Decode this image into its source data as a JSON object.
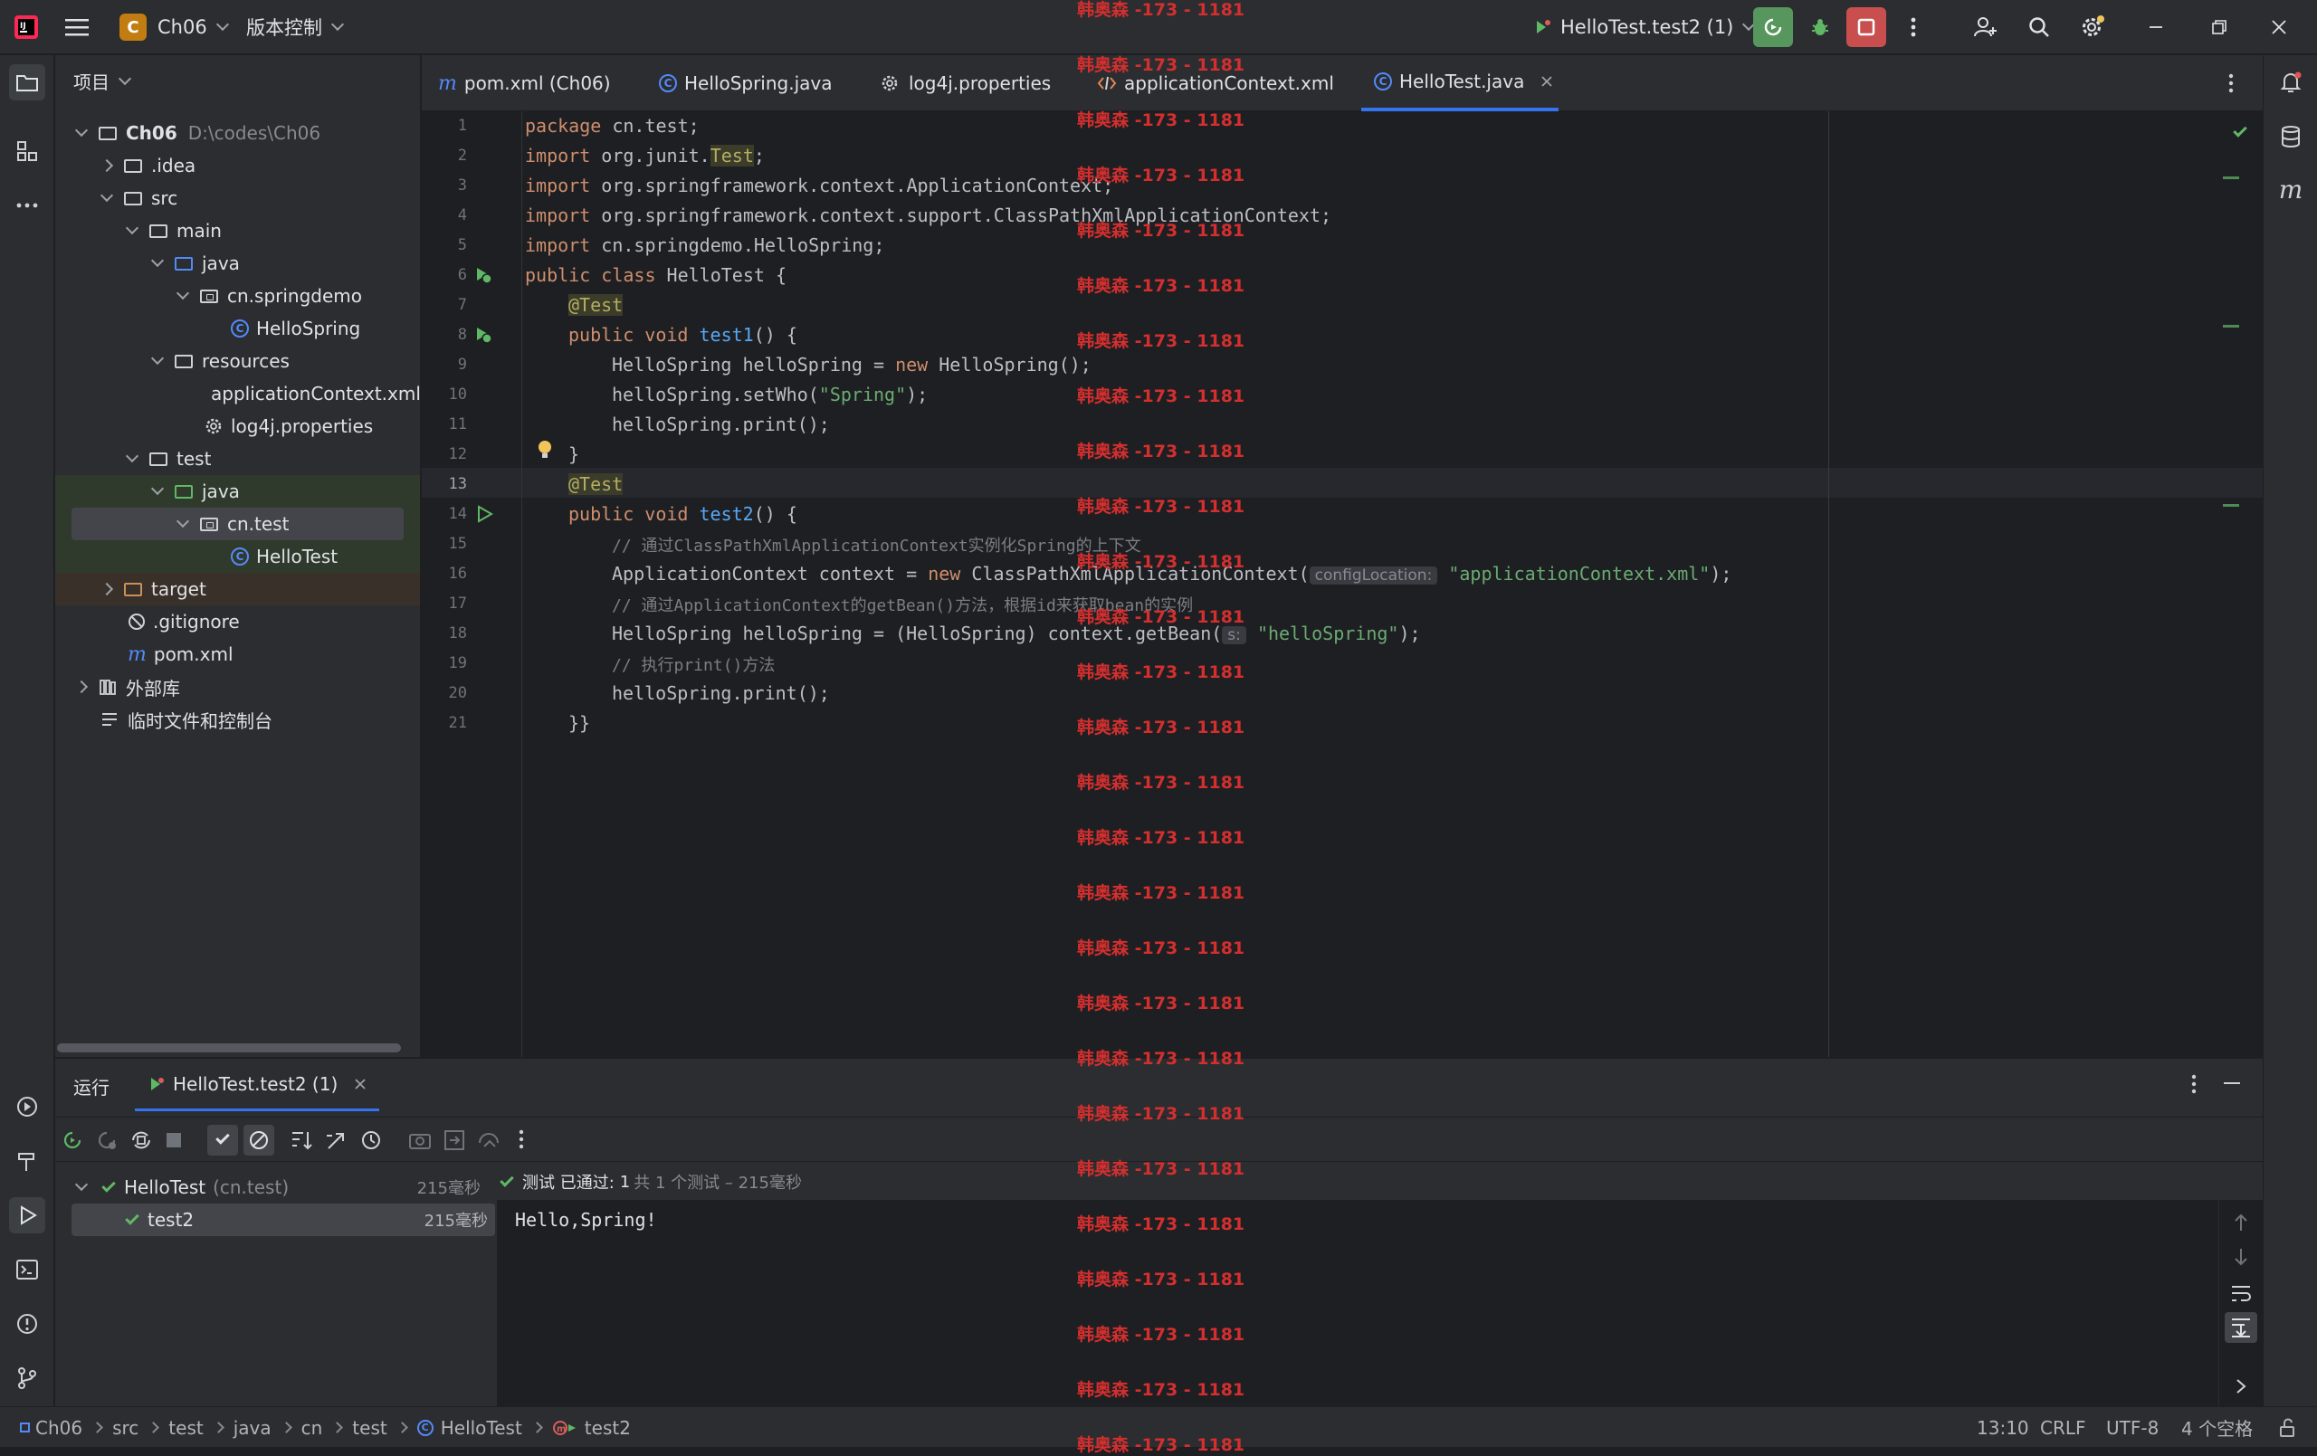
{
  "titlebar": {
    "project_initial": "C",
    "project_name": "Ch06",
    "vcs_label": "版本控制",
    "run_config": "HelloTest.test2 (1)"
  },
  "project_panel": {
    "header": "项目",
    "tree": [
      {
        "label": "Ch06",
        "path": "D:\\codes\\Ch06"
      },
      {
        "label": ".idea"
      },
      {
        "label": "src"
      },
      {
        "label": "main"
      },
      {
        "label": "java"
      },
      {
        "label": "cn.springdemo"
      },
      {
        "label": "HelloSpring"
      },
      {
        "label": "resources"
      },
      {
        "label": "applicationContext.xml"
      },
      {
        "label": "log4j.properties"
      },
      {
        "label": "test"
      },
      {
        "label": "java"
      },
      {
        "label": "cn.test"
      },
      {
        "label": "HelloTest"
      },
      {
        "label": "target"
      },
      {
        "label": ".gitignore"
      },
      {
        "label": "pom.xml"
      },
      {
        "label": "外部库"
      },
      {
        "label": "临时文件和控制台"
      }
    ]
  },
  "tabs": [
    {
      "label": "pom.xml (Ch06)",
      "icon": "maven-icon"
    },
    {
      "label": "HelloSpring.java",
      "icon": "class-icon"
    },
    {
      "label": "log4j.properties",
      "icon": "gear-icon"
    },
    {
      "label": "applicationContext.xml",
      "icon": "xml-icon"
    },
    {
      "label": "HelloTest.java",
      "icon": "class-icon",
      "active": true
    }
  ],
  "code": {
    "line_numbers": [
      "1",
      "2",
      "3",
      "4",
      "5",
      "6",
      "7",
      "8",
      "9",
      "10",
      "11",
      "12",
      "13",
      "14",
      "15",
      "16",
      "17",
      "18",
      "19",
      "20",
      "21"
    ],
    "l1": {
      "kw": "package",
      "rest": " cn.test;"
    },
    "l2": {
      "kw": "import",
      "rest": " org.junit.",
      "ann": "Test",
      "end": ";"
    },
    "l3": {
      "kw": "import",
      "rest": " org.springframework.context.ApplicationContext;"
    },
    "l4": {
      "kw": "import",
      "rest": " org.springframework.context.support.ClassPathXmlApplicationContext;"
    },
    "l5": {
      "kw": "import",
      "rest": " cn.springdemo.HelloSpring;"
    },
    "l6": {
      "kw": "public class",
      "rest": " HelloTest {"
    },
    "l7": {
      "ann": "@Test"
    },
    "l8": {
      "kw": "public void",
      "fn": "test1",
      "rest": "() {"
    },
    "l9": {
      "pre": "HelloSpring helloSpring = ",
      "kw": "new",
      "rest": " HelloSpring();"
    },
    "l10": {
      "pre": "helloSpring.setWho(",
      "str": "\"Spring\"",
      "rest": ");"
    },
    "l11": {
      "rest": "helloSpring.print();"
    },
    "l12": {
      "rest": "}"
    },
    "l13": {
      "ann": "@Test"
    },
    "l14": {
      "kw": "public void",
      "fn": "test2",
      "rest": "() {"
    },
    "l15": {
      "cmt": "// 通过ClassPathXmlApplicationContext实例化Spring的上下文"
    },
    "l16": {
      "pre": "ApplicationContext context = ",
      "kw": "new",
      "mid": " ClassPathXmlApplicationContext(",
      "hint": "configLocation:",
      "str": "\"applicationContext.xml\"",
      "rest": ");"
    },
    "l17": {
      "cmt": "// 通过ApplicationContext的getBean()方法，根据id来获取bean的实例"
    },
    "l18": {
      "pre": "HelloSpring helloSpring = (HelloSpring) context.getBean(",
      "hint": "s:",
      "str": "\"helloSpring\"",
      "rest": ");"
    },
    "l19": {
      "cmt": "// 执行print()方法"
    },
    "l20": {
      "rest": "helloSpring.print();"
    },
    "l21": {
      "rest": "}}"
    }
  },
  "run_panel": {
    "title": "运行",
    "tab": "HelloTest.test2 (1)",
    "tree": [
      {
        "label": "HelloTest",
        "sub": "(cn.test)",
        "time": "215毫秒"
      },
      {
        "label": "test2",
        "time": "215毫秒"
      }
    ],
    "status_prefix": "测试 已通过:",
    "status_count": "1",
    "status_suffix": "共 1 个测试 – 215毫秒",
    "output": "Hello,Spring!"
  },
  "statusbar": {
    "crumbs": [
      "Ch06",
      "src",
      "test",
      "java",
      "cn",
      "test",
      "HelloTest",
      "test2"
    ],
    "position": "13:10",
    "line_sep": "CRLF",
    "encoding": "UTF-8",
    "indent": "4 个空格"
  },
  "watermark": {
    "text": "韩奥森 -173 - 1181"
  },
  "colors": {
    "accent": "#3574f0",
    "pass": "#5fb865",
    "watermark": "#d32f2f"
  }
}
